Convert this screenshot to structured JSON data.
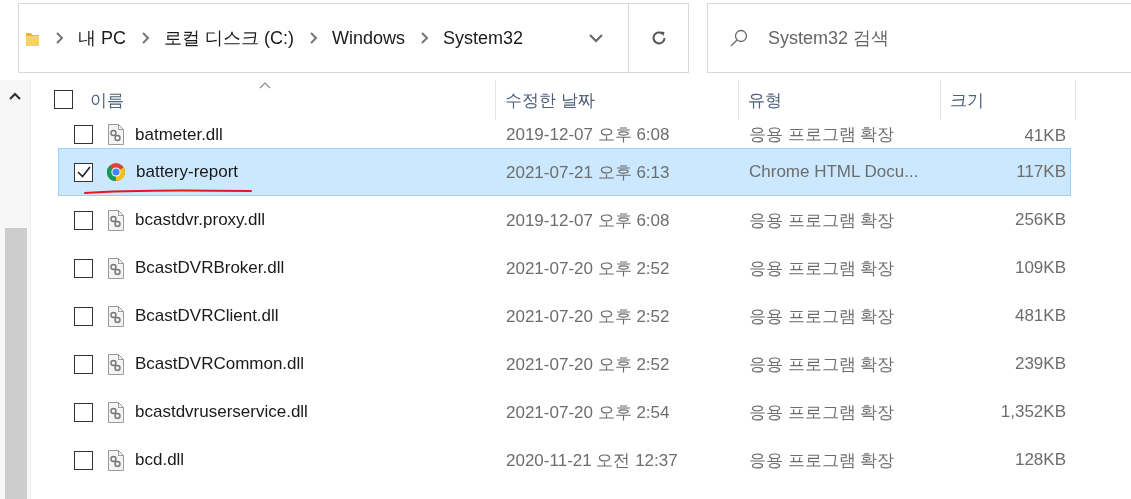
{
  "address_bar": {
    "path": [
      "내 PC",
      "로컬 디스크 (C:)",
      "Windows",
      "System32"
    ]
  },
  "search": {
    "placeholder": "System32 검색"
  },
  "header_checkbox": {
    "checked": false
  },
  "columns": [
    {
      "label": "이름",
      "sorted": true
    },
    {
      "label": "수정한 날짜",
      "sorted": false
    },
    {
      "label": "유형",
      "sorted": false
    },
    {
      "label": "크기",
      "sorted": false
    }
  ],
  "rows": [
    {
      "kind": "dll",
      "name": "batmeter.dll",
      "date": "2019-12-07 오후 6:08",
      "type": "응용 프로그램 확장",
      "size": "41KB",
      "checked": false,
      "selected": false
    },
    {
      "kind": "chrome",
      "name": "battery-report",
      "date": "2021-07-21 오후 6:13",
      "type": "Chrome HTML Docu...",
      "size": "117KB",
      "checked": true,
      "selected": true
    },
    {
      "kind": "dll",
      "name": "bcastdvr.proxy.dll",
      "date": "2019-12-07 오후 6:08",
      "type": "응용 프로그램 확장",
      "size": "256KB",
      "checked": false,
      "selected": false
    },
    {
      "kind": "dll",
      "name": "BcastDVRBroker.dll",
      "date": "2021-07-20 오후 2:52",
      "type": "응용 프로그램 확장",
      "size": "109KB",
      "checked": false,
      "selected": false
    },
    {
      "kind": "dll",
      "name": "BcastDVRClient.dll",
      "date": "2021-07-20 오후 2:52",
      "type": "응용 프로그램 확장",
      "size": "481KB",
      "checked": false,
      "selected": false
    },
    {
      "kind": "dll",
      "name": "BcastDVRCommon.dll",
      "date": "2021-07-20 오후 2:52",
      "type": "응용 프로그램 확장",
      "size": "239KB",
      "checked": false,
      "selected": false
    },
    {
      "kind": "dll",
      "name": "bcastdvruserservice.dll",
      "date": "2021-07-20 오후 2:54",
      "type": "응용 프로그램 확장",
      "size": "1,352KB",
      "checked": false,
      "selected": false
    },
    {
      "kind": "dll",
      "name": "bcd.dll",
      "date": "2020-11-21 오전 12:37",
      "type": "응용 프로그램 확장",
      "size": "128KB",
      "checked": false,
      "selected": false
    }
  ]
}
